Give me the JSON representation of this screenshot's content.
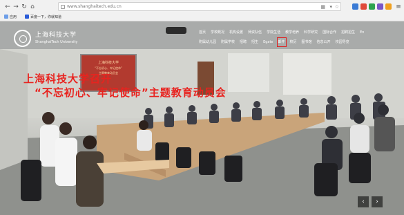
{
  "browser": {
    "url": "www.shanghaitech.edu.cn",
    "bookmarks": [
      "应用",
      "百度一下，你就知道"
    ]
  },
  "site": {
    "logo_cn": "上海科技大学",
    "logo_en": "ShanghaiTech University",
    "nav_primary": [
      "首页",
      "学校概况",
      "机构设置",
      "师资队伍",
      "学院生活",
      "教学培养",
      "科学研究",
      "国际合作",
      "招聘招生",
      "En"
    ],
    "nav_secondary": [
      "附属幼儿园",
      "附属学校",
      "招聘",
      "招生",
      "Egate",
      "邮件",
      "校历",
      "图书馆",
      "信息公开",
      "校园导览"
    ],
    "active_nav": "邮件"
  },
  "hero": {
    "headline_line1": "上海科技大学召开",
    "headline_line2": "“不忘初心、牢记使命”主题教育动员会",
    "screen_line1": "上海科技大学",
    "screen_line2": "“不忘初心、牢记使命”",
    "screen_line3": "主题教育动员会"
  },
  "carousel": {
    "prev": "‹",
    "next": "›"
  },
  "colors": {
    "headline": "#e8231f",
    "active_outline": "#e02020"
  }
}
